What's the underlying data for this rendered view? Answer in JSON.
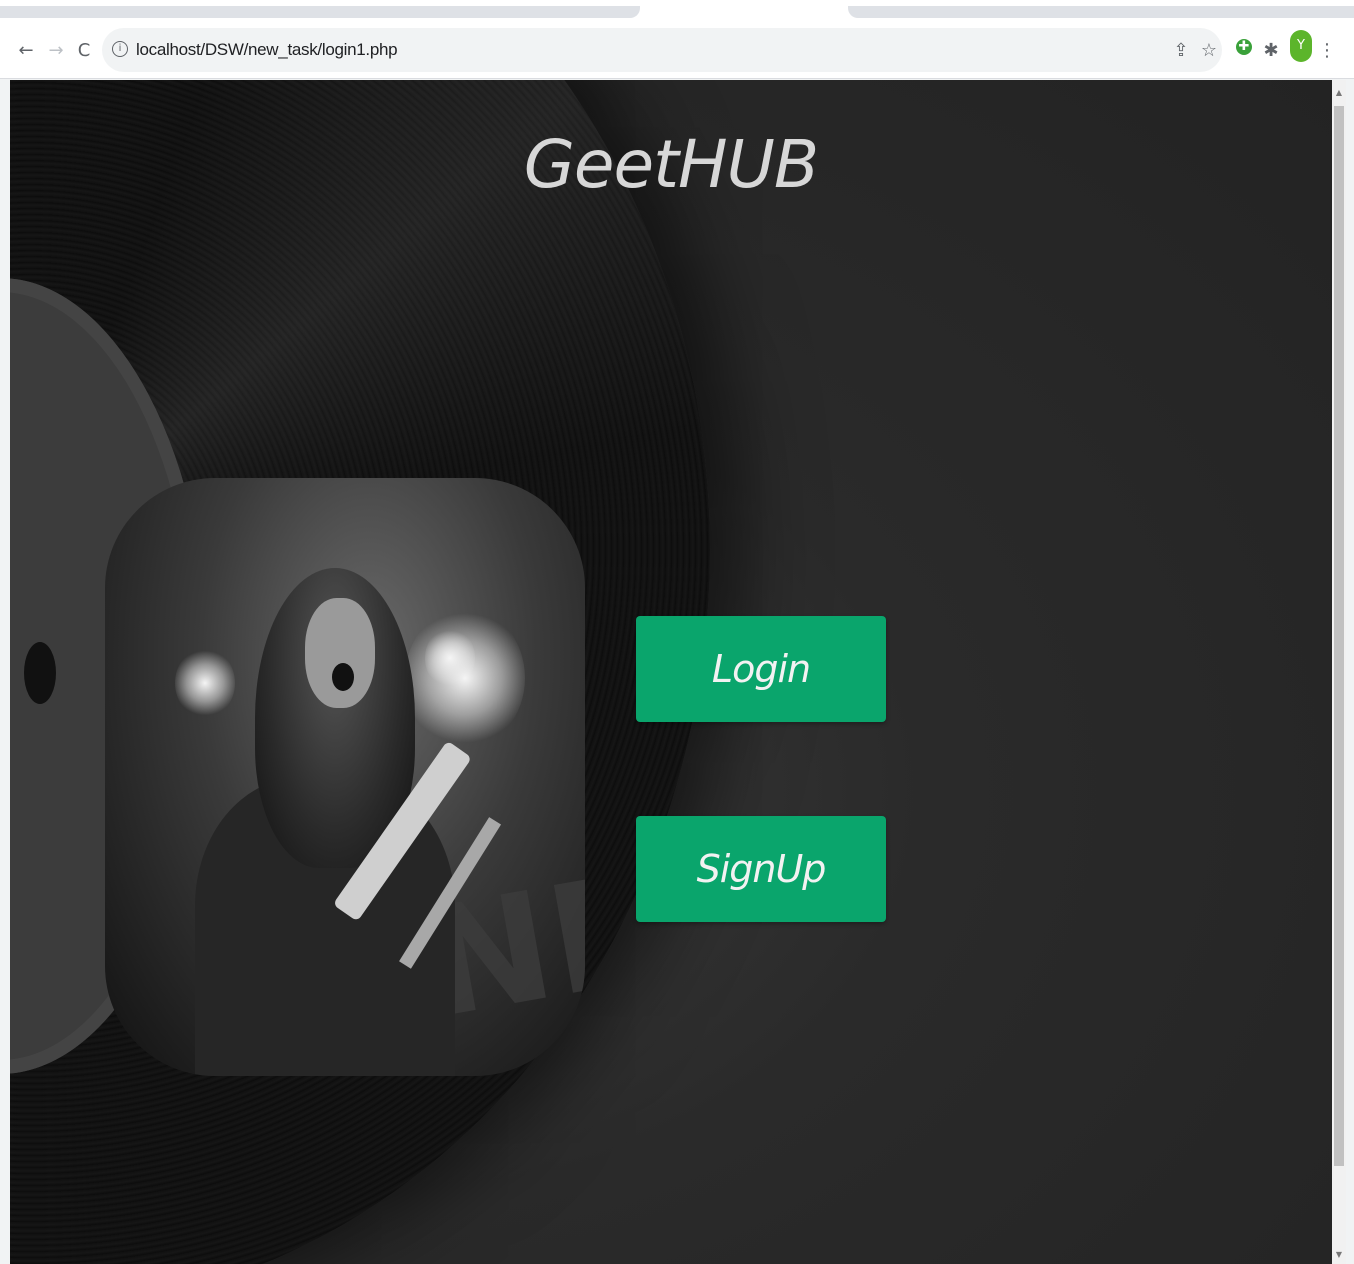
{
  "browser": {
    "url": "localhost/DSW/new_task/login1.php",
    "nav": {
      "back_icon": "←",
      "forward_icon": "→",
      "reload_icon": "C"
    },
    "toolbar_icons": {
      "share_icon": "⇪",
      "star_icon": "☆",
      "extension_icon": "✚",
      "puzzle_icon": "✱",
      "avatar_initial": "Y",
      "menu_icon": "⋮"
    },
    "site_info_icon": "i"
  },
  "page": {
    "title": "GeetHUB",
    "login_label": "Login",
    "signup_label": "SignUp"
  },
  "colors": {
    "button": "#0aa56c",
    "background": "#232323",
    "title": "#d7d7d7"
  }
}
